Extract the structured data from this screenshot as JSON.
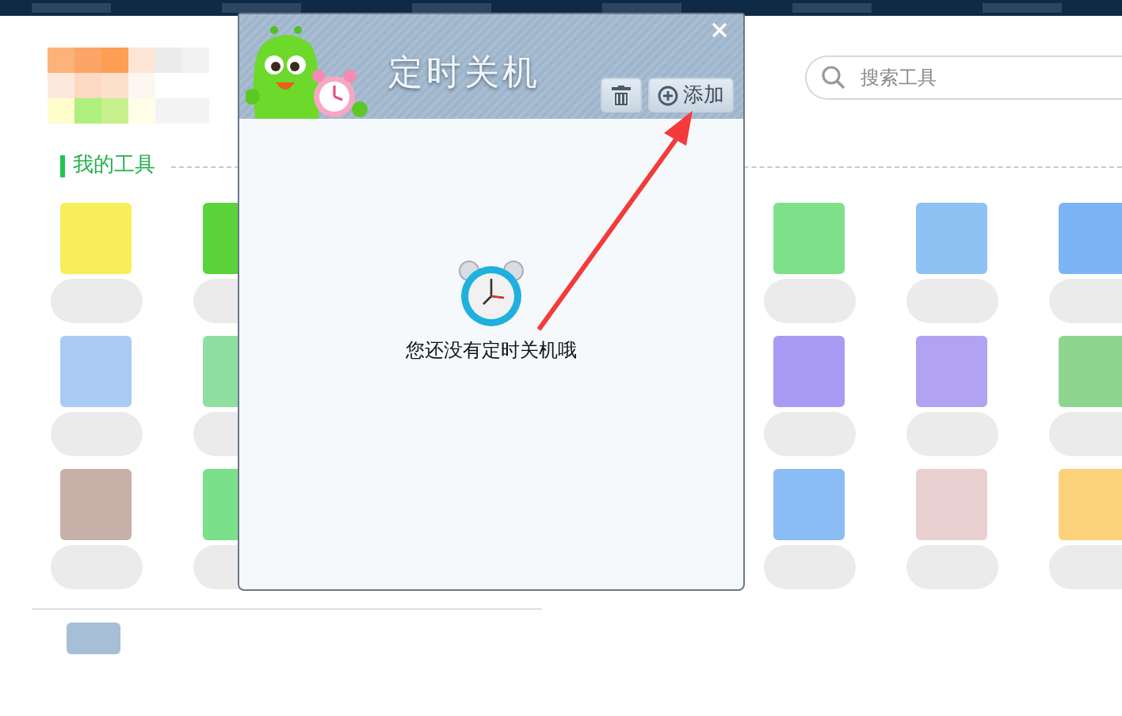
{
  "search": {
    "placeholder": "搜索工具"
  },
  "section": {
    "title": "我的工具"
  },
  "dialog": {
    "title": "定时关机",
    "add_button": "添加",
    "empty_message": "您还没有定时关机哦"
  }
}
